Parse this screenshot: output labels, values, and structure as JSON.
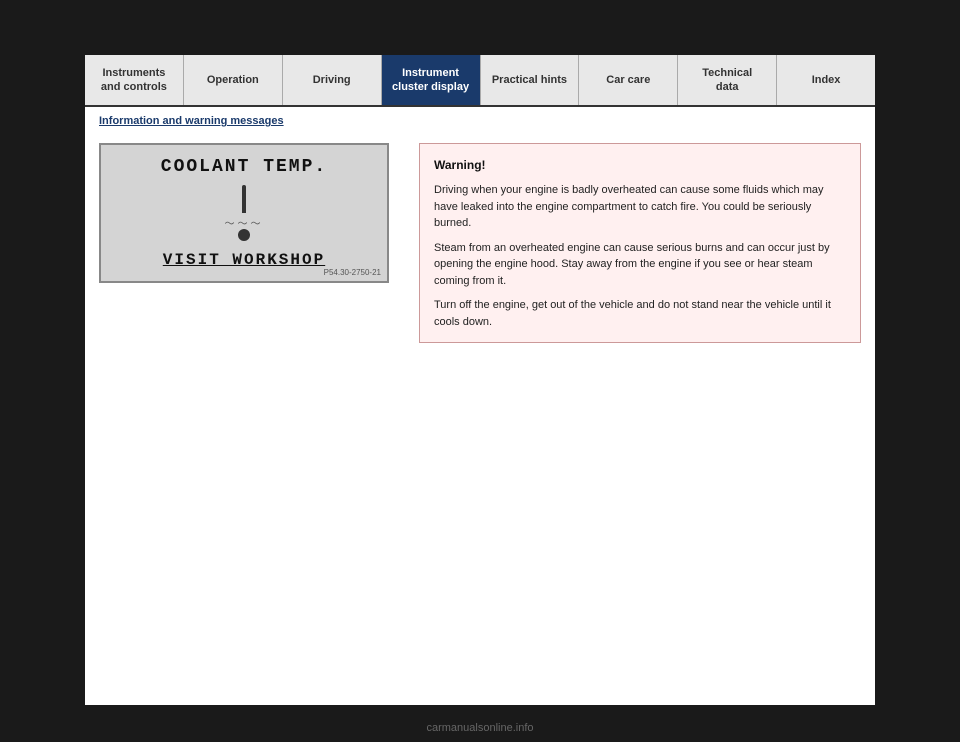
{
  "nav": {
    "tabs": [
      {
        "id": "instruments",
        "label": "Instruments\nand controls",
        "active": false
      },
      {
        "id": "operation",
        "label": "Operation",
        "active": false
      },
      {
        "id": "driving",
        "label": "Driving",
        "active": false
      },
      {
        "id": "instrument-cluster",
        "label": "Instrument\ncluster display",
        "active": true
      },
      {
        "id": "practical-hints",
        "label": "Practical hints",
        "active": false
      },
      {
        "id": "car-care",
        "label": "Car care",
        "active": false
      },
      {
        "id": "technical-data",
        "label": "Technical\ndata",
        "active": false
      },
      {
        "id": "index",
        "label": "Index",
        "active": false
      }
    ]
  },
  "section": {
    "heading": "Information and warning messages"
  },
  "display": {
    "line1": "COOLANT TEMP.",
    "line2": "VISIT WORKSHOP",
    "ref": "P54.30-2750-21"
  },
  "warning": {
    "title": "Warning!",
    "paragraphs": [
      "Driving when your engine is badly overheated can cause some fluids which may have leaked into the engine compartment to catch fire. You could be seriously burned.",
      "Steam from an overheated engine can cause serious burns and can occur just by opening the engine hood. Stay away from the engine if you see or hear steam coming from it.",
      "Turn off the engine, get out of the vehicle and do not stand near the vehicle until it cools down."
    ]
  },
  "watermark": "carmanualsonline.info"
}
